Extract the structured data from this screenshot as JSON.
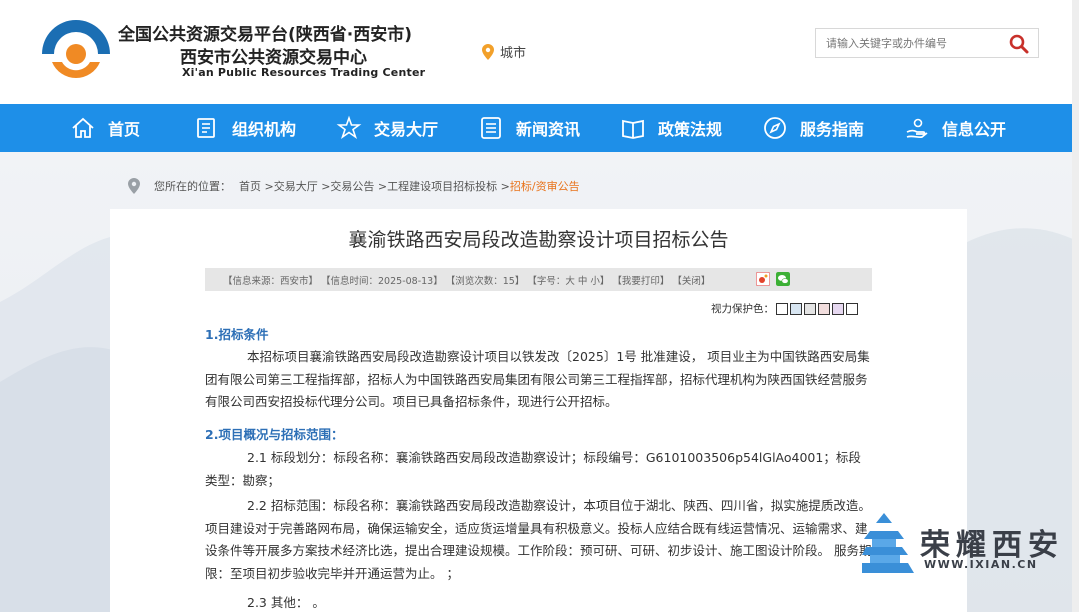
{
  "header": {
    "title_cn1": "全国公共资源交易平台(陕西省·西安市)",
    "title_cn2": "西安市公共资源交易中心",
    "title_en": "Xi'an Public Resources Trading Center",
    "city_label": "城市",
    "search_placeholder": "请输入关键字或办件编号"
  },
  "nav": {
    "items": [
      {
        "label": "首页",
        "icon": "home-icon"
      },
      {
        "label": "组织机构",
        "icon": "document-icon"
      },
      {
        "label": "交易大厅",
        "icon": "star-icon"
      },
      {
        "label": "新闻资讯",
        "icon": "list-icon"
      },
      {
        "label": "政策法规",
        "icon": "book-icon"
      },
      {
        "label": "服务指南",
        "icon": "compass-icon"
      },
      {
        "label": "信息公开",
        "icon": "hand-icon"
      }
    ]
  },
  "breadcrumb": {
    "prefix": "您所在的位置：",
    "path": "首页 >交易大厅 >交易公告 >工程建设项目招标投标 >",
    "current": "招标/资审公告"
  },
  "article": {
    "title": "襄渝铁路西安局段改造勘察设计项目招标公告",
    "info": {
      "source": "【信息来源：西安市】",
      "time": "【信息时间：2025-08-13】",
      "views": "【浏览次数：15】",
      "font": "【字号：大 中 小】",
      "print": "【我要打印】",
      "close": "【关闭】"
    },
    "eye_care_label": "视力保护色：",
    "eye_colors": [
      "#ffffff",
      "#d8e6f2",
      "#e4e4e4",
      "#f2dede",
      "#e6d8f0",
      "#ffffff"
    ],
    "sec1_title": "1.招标条件",
    "sec1_p1": "本招标项目襄渝铁路西安局段改造勘察设计项目以铁发改〔2025〕1号 批准建设， 项目业主为中国铁路西安局集团有限公司第三工程指挥部，招标人为中国铁路西安局集团有限公司第三工程指挥部，招标代理机构为陕西国铁经营服务有限公司西安招投标代理分公司。项目已具备招标条件，现进行公开招标。",
    "sec2_title": "2.项目概况与招标范围：",
    "sec2_p1": "2.1 标段划分：标段名称：襄渝铁路西安局段改造勘察设计；标段编号：G6101003506p54lGlAo4001；标段类型：勘察；",
    "sec2_p2": "2.2 招标范围：标段名称：襄渝铁路西安局段改造勘察设计，本项目位于湖北、陕西、四川省，拟实施提质改造。项目建设对于完善路网布局，确保运输安全，适应货运增量具有积极意义。投标人应结合既有线运营情况、运输需求、建设条件等开展多方案技术经济比选，提出合理建设规模。工作阶段：预可研、可研、初步设计、施工图设计阶段。 服务期限：至项目初步验收完毕并开通运营为止。 ；",
    "sec2_p3": "2.3 其他： 。"
  },
  "watermark": {
    "text": "荣耀西安",
    "url": "WWW.IXIAN.CN"
  },
  "colors": {
    "nav_bg": "#1e8fe8",
    "section_title": "#2d6fb6",
    "breadcrumb_current": "#e8731c"
  }
}
